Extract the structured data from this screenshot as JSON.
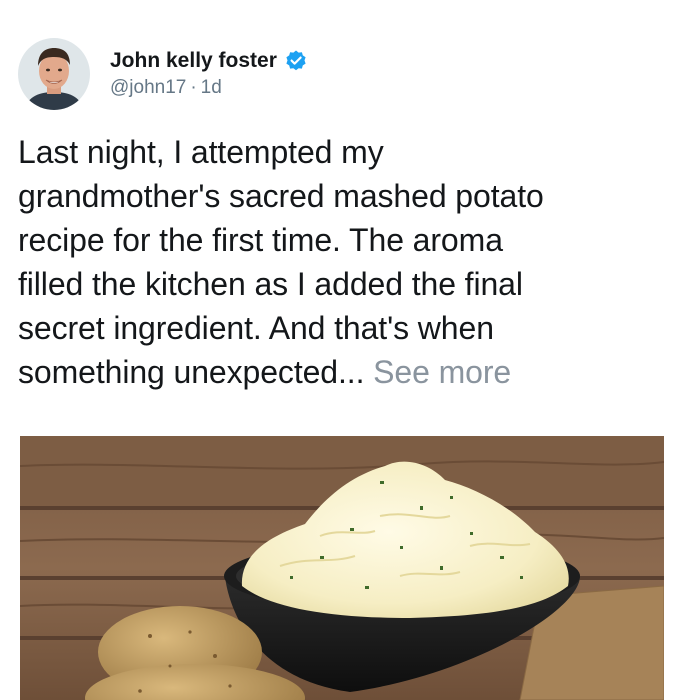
{
  "post": {
    "author": {
      "display_name": "John kelly foster",
      "handle": "@john17",
      "separator": "·",
      "time": "1d",
      "verified": true,
      "avatar_icon": "profile-photo"
    },
    "text": {
      "lines": [
        "Last night, I attempted my",
        "grandmother's sacred mashed potato",
        "recipe for the first time. The aroma",
        "filled the kitchen as I added the final",
        "secret ingredient. And that's when",
        "something unexpected..."
      ],
      "see_more": "See more"
    },
    "media": {
      "icon": "mashed-potatoes-photo"
    }
  },
  "colors": {
    "verified_badge": "#1da1f2",
    "meta_text": "#657786",
    "see_more": "#8a949e",
    "body_text": "#14171a"
  }
}
